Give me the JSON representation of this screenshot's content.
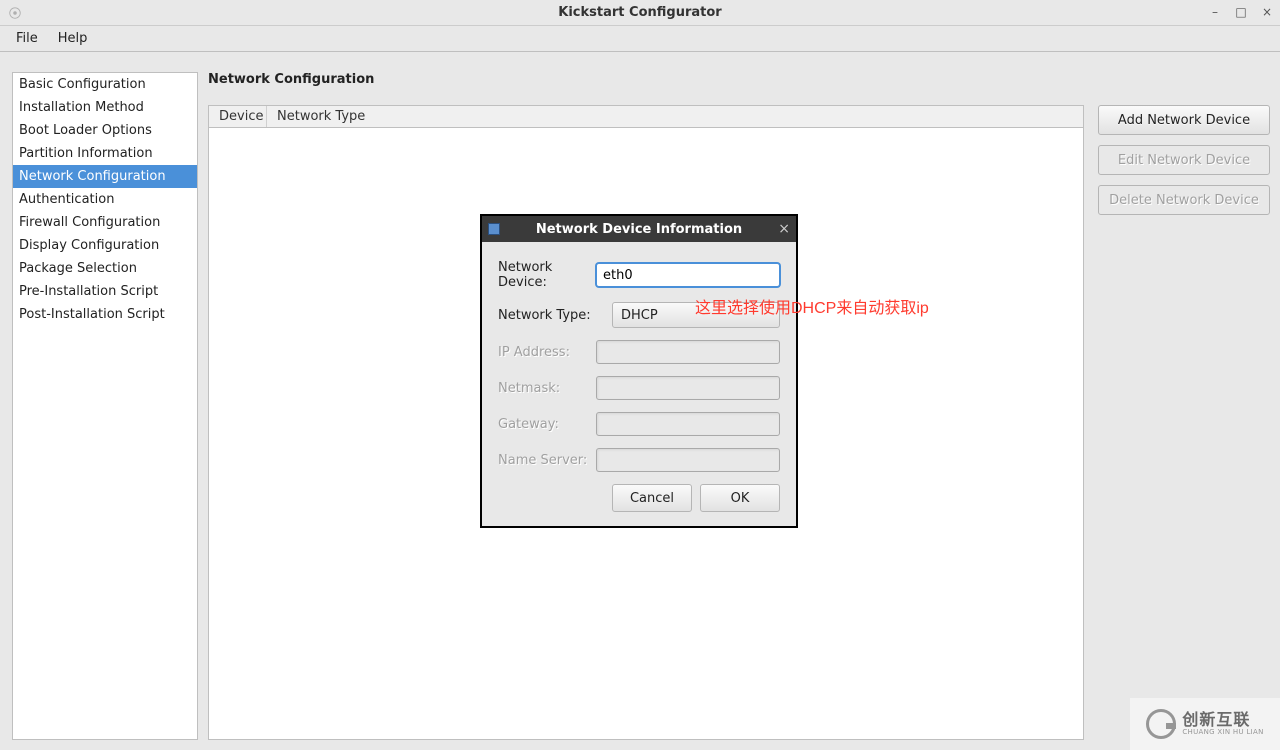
{
  "window": {
    "title": "Kickstart Configurator"
  },
  "menubar": {
    "file": "File",
    "help": "Help"
  },
  "sidebar": {
    "items": [
      "Basic Configuration",
      "Installation Method",
      "Boot Loader Options",
      "Partition Information",
      "Network Configuration",
      "Authentication",
      "Firewall Configuration",
      "Display Configuration",
      "Package Selection",
      "Pre-Installation Script",
      "Post-Installation Script"
    ],
    "selected_index": 4
  },
  "content": {
    "title": "Network Configuration",
    "table": {
      "columns": {
        "device": "Device",
        "type": "Network Type"
      }
    },
    "buttons": {
      "add": "Add Network Device",
      "edit": "Edit Network Device",
      "delete": "Delete Network Device"
    }
  },
  "dialog": {
    "title": "Network Device Information",
    "fields": {
      "device_label": "Network Device:",
      "device_value": "eth0",
      "type_label": "Network Type:",
      "type_value": "DHCP",
      "ip_label": "IP Address:",
      "netmask_label": "Netmask:",
      "gateway_label": "Gateway:",
      "ns_label": "Name Server:"
    },
    "buttons": {
      "cancel": "Cancel",
      "ok": "OK"
    }
  },
  "annotation": "这里选择使用DHCP来自动获取ip",
  "watermark": {
    "cn": "创新互联",
    "en": "CHUANG XIN HU LIAN"
  }
}
